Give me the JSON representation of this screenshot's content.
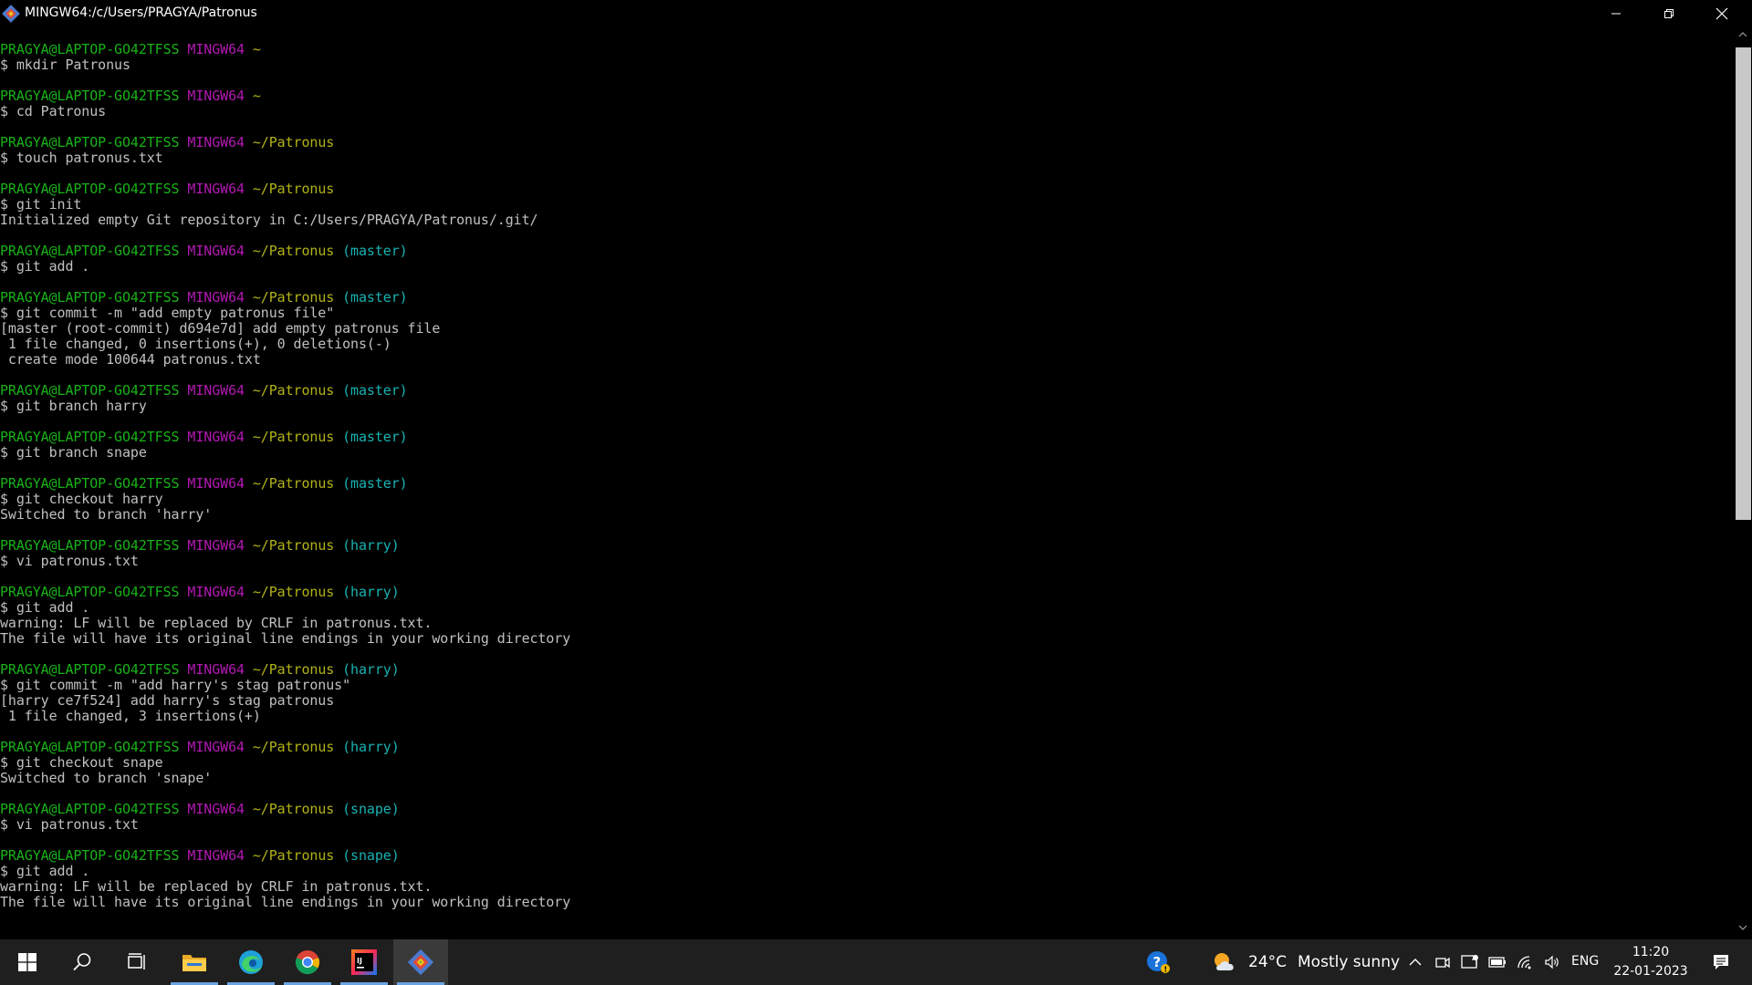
{
  "window": {
    "title": "MINGW64:/c/Users/PRAGYA/Patronus",
    "minimize_icon": "minimize-icon",
    "maximize_icon": "restore-icon",
    "close_icon": "close-icon"
  },
  "terminal": {
    "lines": [
      {
        "type": "prompt",
        "user": "PRAGYA@LAPTOP-GO42TFSS",
        "host": "MINGW64",
        "path": "~",
        "branch": ""
      },
      {
        "type": "cmd",
        "text": "$ mkdir Patronus"
      },
      {
        "type": "blank"
      },
      {
        "type": "prompt",
        "user": "PRAGYA@LAPTOP-GO42TFSS",
        "host": "MINGW64",
        "path": "~",
        "branch": ""
      },
      {
        "type": "cmd",
        "text": "$ cd Patronus"
      },
      {
        "type": "blank"
      },
      {
        "type": "prompt",
        "user": "PRAGYA@LAPTOP-GO42TFSS",
        "host": "MINGW64",
        "path": "~/Patronus",
        "branch": ""
      },
      {
        "type": "cmd",
        "text": "$ touch patronus.txt"
      },
      {
        "type": "blank"
      },
      {
        "type": "prompt",
        "user": "PRAGYA@LAPTOP-GO42TFSS",
        "host": "MINGW64",
        "path": "~/Patronus",
        "branch": ""
      },
      {
        "type": "cmd",
        "text": "$ git init"
      },
      {
        "type": "out",
        "text": "Initialized empty Git repository in C:/Users/PRAGYA/Patronus/.git/"
      },
      {
        "type": "blank"
      },
      {
        "type": "prompt",
        "user": "PRAGYA@LAPTOP-GO42TFSS",
        "host": "MINGW64",
        "path": "~/Patronus",
        "branch": "(master)"
      },
      {
        "type": "cmd",
        "text": "$ git add ."
      },
      {
        "type": "blank"
      },
      {
        "type": "prompt",
        "user": "PRAGYA@LAPTOP-GO42TFSS",
        "host": "MINGW64",
        "path": "~/Patronus",
        "branch": "(master)"
      },
      {
        "type": "cmd",
        "text": "$ git commit -m \"add empty patronus file\""
      },
      {
        "type": "out",
        "text": "[master (root-commit) d694e7d] add empty patronus file"
      },
      {
        "type": "out",
        "text": " 1 file changed, 0 insertions(+), 0 deletions(-)"
      },
      {
        "type": "out",
        "text": " create mode 100644 patronus.txt"
      },
      {
        "type": "blank"
      },
      {
        "type": "prompt",
        "user": "PRAGYA@LAPTOP-GO42TFSS",
        "host": "MINGW64",
        "path": "~/Patronus",
        "branch": "(master)"
      },
      {
        "type": "cmd",
        "text": "$ git branch harry"
      },
      {
        "type": "blank"
      },
      {
        "type": "prompt",
        "user": "PRAGYA@LAPTOP-GO42TFSS",
        "host": "MINGW64",
        "path": "~/Patronus",
        "branch": "(master)"
      },
      {
        "type": "cmd",
        "text": "$ git branch snape"
      },
      {
        "type": "blank"
      },
      {
        "type": "prompt",
        "user": "PRAGYA@LAPTOP-GO42TFSS",
        "host": "MINGW64",
        "path": "~/Patronus",
        "branch": "(master)"
      },
      {
        "type": "cmd",
        "text": "$ git checkout harry"
      },
      {
        "type": "out",
        "text": "Switched to branch 'harry'"
      },
      {
        "type": "blank"
      },
      {
        "type": "prompt",
        "user": "PRAGYA@LAPTOP-GO42TFSS",
        "host": "MINGW64",
        "path": "~/Patronus",
        "branch": "(harry)"
      },
      {
        "type": "cmd",
        "text": "$ vi patronus.txt"
      },
      {
        "type": "blank"
      },
      {
        "type": "prompt",
        "user": "PRAGYA@LAPTOP-GO42TFSS",
        "host": "MINGW64",
        "path": "~/Patronus",
        "branch": "(harry)"
      },
      {
        "type": "cmd",
        "text": "$ git add ."
      },
      {
        "type": "out",
        "text": "warning: LF will be replaced by CRLF in patronus.txt."
      },
      {
        "type": "out",
        "text": "The file will have its original line endings in your working directory"
      },
      {
        "type": "blank"
      },
      {
        "type": "prompt",
        "user": "PRAGYA@LAPTOP-GO42TFSS",
        "host": "MINGW64",
        "path": "~/Patronus",
        "branch": "(harry)"
      },
      {
        "type": "cmd",
        "text": "$ git commit -m \"add harry's stag patronus\""
      },
      {
        "type": "out",
        "text": "[harry ce7f524] add harry's stag patronus"
      },
      {
        "type": "out",
        "text": " 1 file changed, 3 insertions(+)"
      },
      {
        "type": "blank"
      },
      {
        "type": "prompt",
        "user": "PRAGYA@LAPTOP-GO42TFSS",
        "host": "MINGW64",
        "path": "~/Patronus",
        "branch": "(harry)"
      },
      {
        "type": "cmd",
        "text": "$ git checkout snape"
      },
      {
        "type": "out",
        "text": "Switched to branch 'snape'"
      },
      {
        "type": "blank"
      },
      {
        "type": "prompt",
        "user": "PRAGYA@LAPTOP-GO42TFSS",
        "host": "MINGW64",
        "path": "~/Patronus",
        "branch": "(snape)"
      },
      {
        "type": "cmd",
        "text": "$ vi patronus.txt"
      },
      {
        "type": "blank"
      },
      {
        "type": "prompt",
        "user": "PRAGYA@LAPTOP-GO42TFSS",
        "host": "MINGW64",
        "path": "~/Patronus",
        "branch": "(snape)"
      },
      {
        "type": "cmd",
        "text": "$ git add ."
      },
      {
        "type": "out",
        "text": "warning: LF will be replaced by CRLF in patronus.txt."
      },
      {
        "type": "out",
        "text": "The file will have its original line endings in your working directory"
      }
    ]
  },
  "taskbar": {
    "items": [
      {
        "name": "start-button",
        "icon": "windows-logo-icon"
      },
      {
        "name": "search-button",
        "icon": "search-icon"
      },
      {
        "name": "task-view-button",
        "icon": "task-view-icon"
      },
      {
        "name": "taskbar-file-explorer",
        "icon": "folder-icon"
      },
      {
        "name": "taskbar-edge",
        "icon": "edge-icon"
      },
      {
        "name": "taskbar-chrome",
        "icon": "chrome-icon"
      },
      {
        "name": "taskbar-intellij",
        "icon": "intellij-icon"
      },
      {
        "name": "taskbar-git-bash",
        "icon": "git-bash-icon"
      }
    ],
    "weather": {
      "temp": "24°C",
      "desc": "Mostly sunny",
      "icon": "partly-sunny-icon"
    },
    "tray_icons": [
      "help-icon",
      "chevron-up-icon",
      "meet-now-icon",
      "defender-icon",
      "battery-icon",
      "wifi-icon",
      "volume-icon"
    ],
    "language": "ENG",
    "time": "11:20",
    "date": "22-01-2023",
    "notification_icon": "notification-icon"
  },
  "colors": {
    "user": "#18b218",
    "host": "#b218b2",
    "path": "#b2b218",
    "branch": "#18b2b2",
    "text": "#c0c0c0",
    "background": "#000000",
    "taskbar": "#1f1f1f"
  }
}
